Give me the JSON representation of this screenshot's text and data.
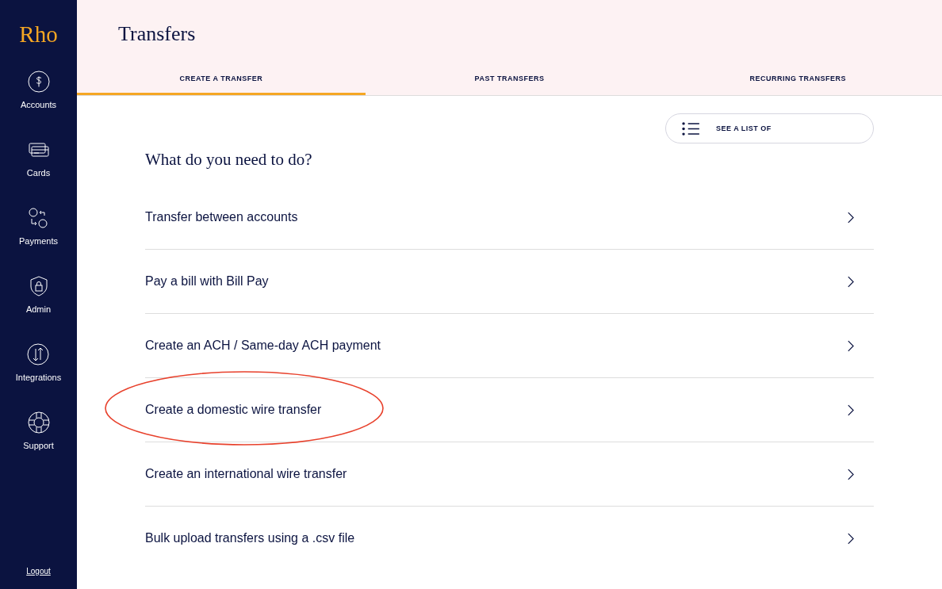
{
  "sidebar": {
    "logo": "Rho",
    "items": [
      {
        "kind": "accounts",
        "label": "Accounts"
      },
      {
        "kind": "cards",
        "label": "Cards"
      },
      {
        "kind": "payments",
        "label": "Payments"
      },
      {
        "kind": "admin",
        "label": "Admin"
      },
      {
        "kind": "integrations",
        "label": "Integrations"
      },
      {
        "kind": "support",
        "label": "Support"
      }
    ],
    "logout": "Logout"
  },
  "header": {
    "title": "Transfers"
  },
  "tabs": [
    {
      "label": "CREATE A TRANSFER",
      "selected": true
    },
    {
      "label": "PAST TRANSFERS",
      "selected": false
    },
    {
      "label": "RECURRING TRANSFERS",
      "selected": false
    }
  ],
  "list_button": "SEE A LIST OF",
  "question": "What do you need to do?",
  "options": [
    {
      "label": "Transfer between accounts",
      "circled": false
    },
    {
      "label": "Pay a bill with Bill Pay",
      "circled": false
    },
    {
      "label": "Create an ACH / Same-day ACH payment",
      "circled": false
    },
    {
      "label": "Create a domestic wire transfer",
      "circled": true
    },
    {
      "label": "Create an international wire transfer",
      "circled": false
    },
    {
      "label": "Bulk upload transfers using a .csv file",
      "circled": false
    }
  ]
}
